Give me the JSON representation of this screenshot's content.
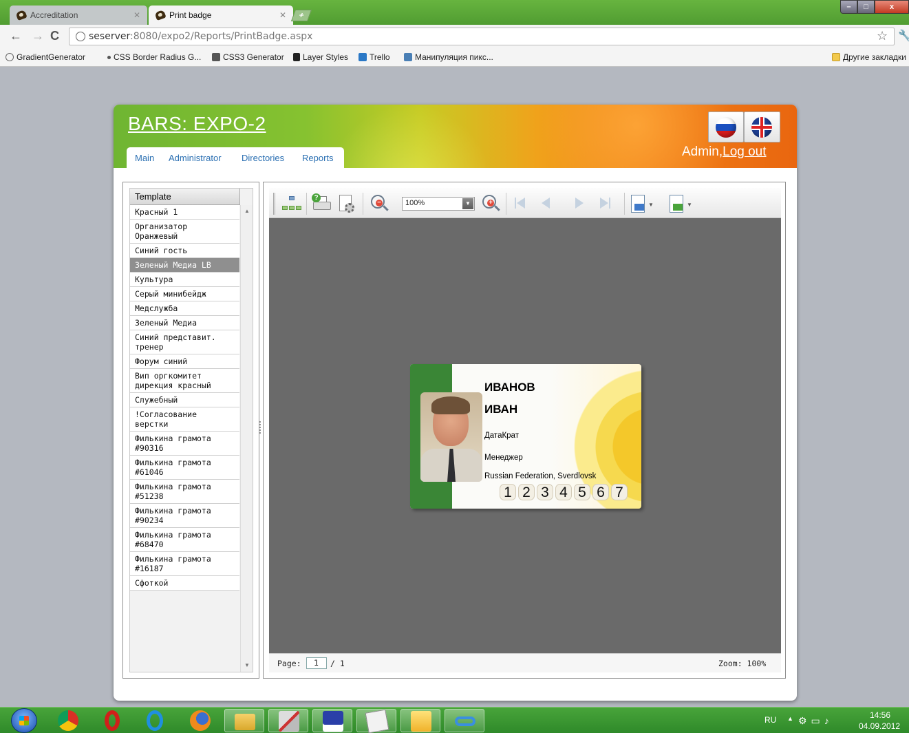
{
  "browser": {
    "tabs": [
      {
        "title": "Accreditation",
        "active": false
      },
      {
        "title": "Print badge",
        "active": true
      }
    ],
    "new_tab_label": "+",
    "window_buttons": {
      "minimize": "–",
      "maximize": "□",
      "close": "x"
    },
    "url_host": "seserver",
    "url_rest": ":8080/expo2/Reports/PrintBadge.aspx",
    "bookmarks": [
      {
        "label": "GradientGenerator",
        "icon": "globe-icon"
      },
      {
        "label": "CSS Border Radius G...",
        "icon": "dot-icon"
      },
      {
        "label": "CSS3 Generator",
        "icon": "css3-icon"
      },
      {
        "label": "Layer Styles",
        "icon": "ls-icon"
      },
      {
        "label": "Trello",
        "icon": "trello-icon"
      },
      {
        "label": "Манипуляция пикс...",
        "icon": "grid-icon"
      }
    ],
    "other_bookmarks": "Другие закладки"
  },
  "app": {
    "brand": "BARS: EXPO-2",
    "nav": [
      "Main",
      "Administrator",
      "Directories",
      "Reports"
    ],
    "user_name": "Admin,",
    "logout": "Log out",
    "languages": [
      "ru",
      "en"
    ]
  },
  "templates": {
    "header": "Template",
    "items": [
      {
        "label": "Красный 1",
        "selected": false
      },
      {
        "label": "Организатор\nОранжевый",
        "selected": false
      },
      {
        "label": "Синий гость",
        "selected": false
      },
      {
        "label": "Зеленый Медиа LB",
        "selected": true
      },
      {
        "label": "Культура",
        "selected": false
      },
      {
        "label": "Серый минибейдж",
        "selected": false
      },
      {
        "label": "Медслужба",
        "selected": false
      },
      {
        "label": "Зеленый Медиа",
        "selected": false
      },
      {
        "label": "Синий представит.\nтренер",
        "selected": false
      },
      {
        "label": "Форум синий",
        "selected": false
      },
      {
        "label": "Вип оргкомитет\nдирекция красный",
        "selected": false
      },
      {
        "label": "Служебный",
        "selected": false
      },
      {
        "label": "!Согласование\nверстки",
        "selected": false
      },
      {
        "label": "Филькина грамота\n#90316",
        "selected": false
      },
      {
        "label": "Филькина грамота\n#61046",
        "selected": false
      },
      {
        "label": "Филькина грамота\n#51238",
        "selected": false
      },
      {
        "label": "Филькина грамота\n#90234",
        "selected": false
      },
      {
        "label": "Филькина грамота\n#68470",
        "selected": false
      },
      {
        "label": "Филькина грамота\n#16187",
        "selected": false
      },
      {
        "label": "Сфоткой",
        "selected": false
      }
    ]
  },
  "viewer": {
    "zoom_value": "100%",
    "page_label": "Page:",
    "page_current": "1",
    "page_total": "/ 1",
    "zoom_status": "Zoom: 100%"
  },
  "badge": {
    "last_name": "ИВАНОВ",
    "first_name": "ИВАН",
    "company": "ДатаКрат",
    "position": "Менеджер",
    "location": "Russian Federation, Sverdlovsk",
    "number_digits": [
      "1",
      "2",
      "3",
      "4",
      "5",
      "6",
      "7"
    ],
    "colors": {
      "band": "#3a8636",
      "accent": "#f4c82a"
    }
  },
  "taskbar": {
    "apps": [
      "chrome-icon",
      "opera-icon",
      "ie-icon",
      "firefox-icon",
      "explorer-icon",
      "tools-icon",
      "save-icon",
      "notepad-icon",
      "outlook-icon",
      "link-icon"
    ],
    "lang": "RU",
    "time": "14:56",
    "date": "04.09.2012"
  }
}
